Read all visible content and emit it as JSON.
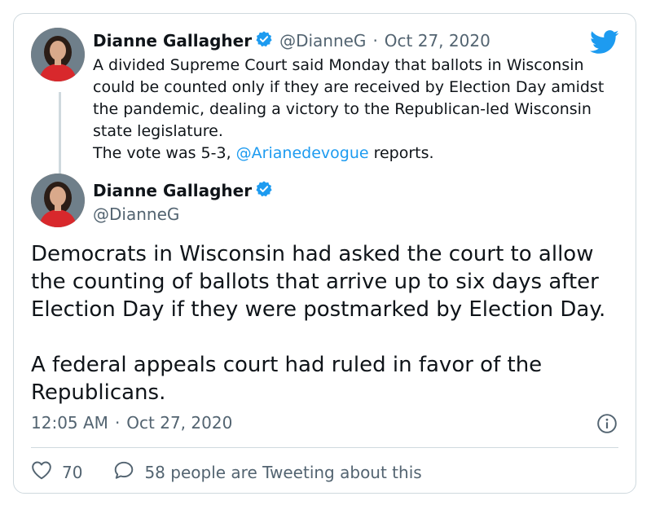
{
  "reply_tweet": {
    "author_name": "Dianne Gallagher",
    "handle": "@DianneG",
    "separator": "·",
    "date": "Oct 27, 2020",
    "text_before_mention": "A divided Supreme Court said Monday that ballots in Wisconsin could be counted only if they are received by Election Day amidst the pandemic, dealing a victory to the Republican-led Wisconsin state legislature.",
    "text_line2_prefix": "The vote was 5-3, ",
    "mention": "@Arianedevogue",
    "text_line2_suffix": " reports."
  },
  "main_tweet": {
    "author_name": "Dianne Gallagher",
    "handle": "@DianneG",
    "paragraph1": "Democrats in Wisconsin had asked the court to allow the counting of ballots that arrive up to six days after Election Day if they were postmarked by Election Day.",
    "paragraph2": "A federal appeals court had ruled in favor of the Republicans.",
    "time": "12:05 AM",
    "separator": "·",
    "date": "Oct 27, 2020"
  },
  "actions": {
    "like_count": "70",
    "tweeting_text": "58 people are Tweeting about this"
  },
  "colors": {
    "accent": "#1d9bf0",
    "verified": "#1d9bf0",
    "muted_text": "#536471",
    "border": "#cfd9de"
  },
  "icons": [
    "twitter-bird-icon",
    "verified-badge-icon",
    "info-icon",
    "heart-icon",
    "speech-bubble-icon"
  ]
}
